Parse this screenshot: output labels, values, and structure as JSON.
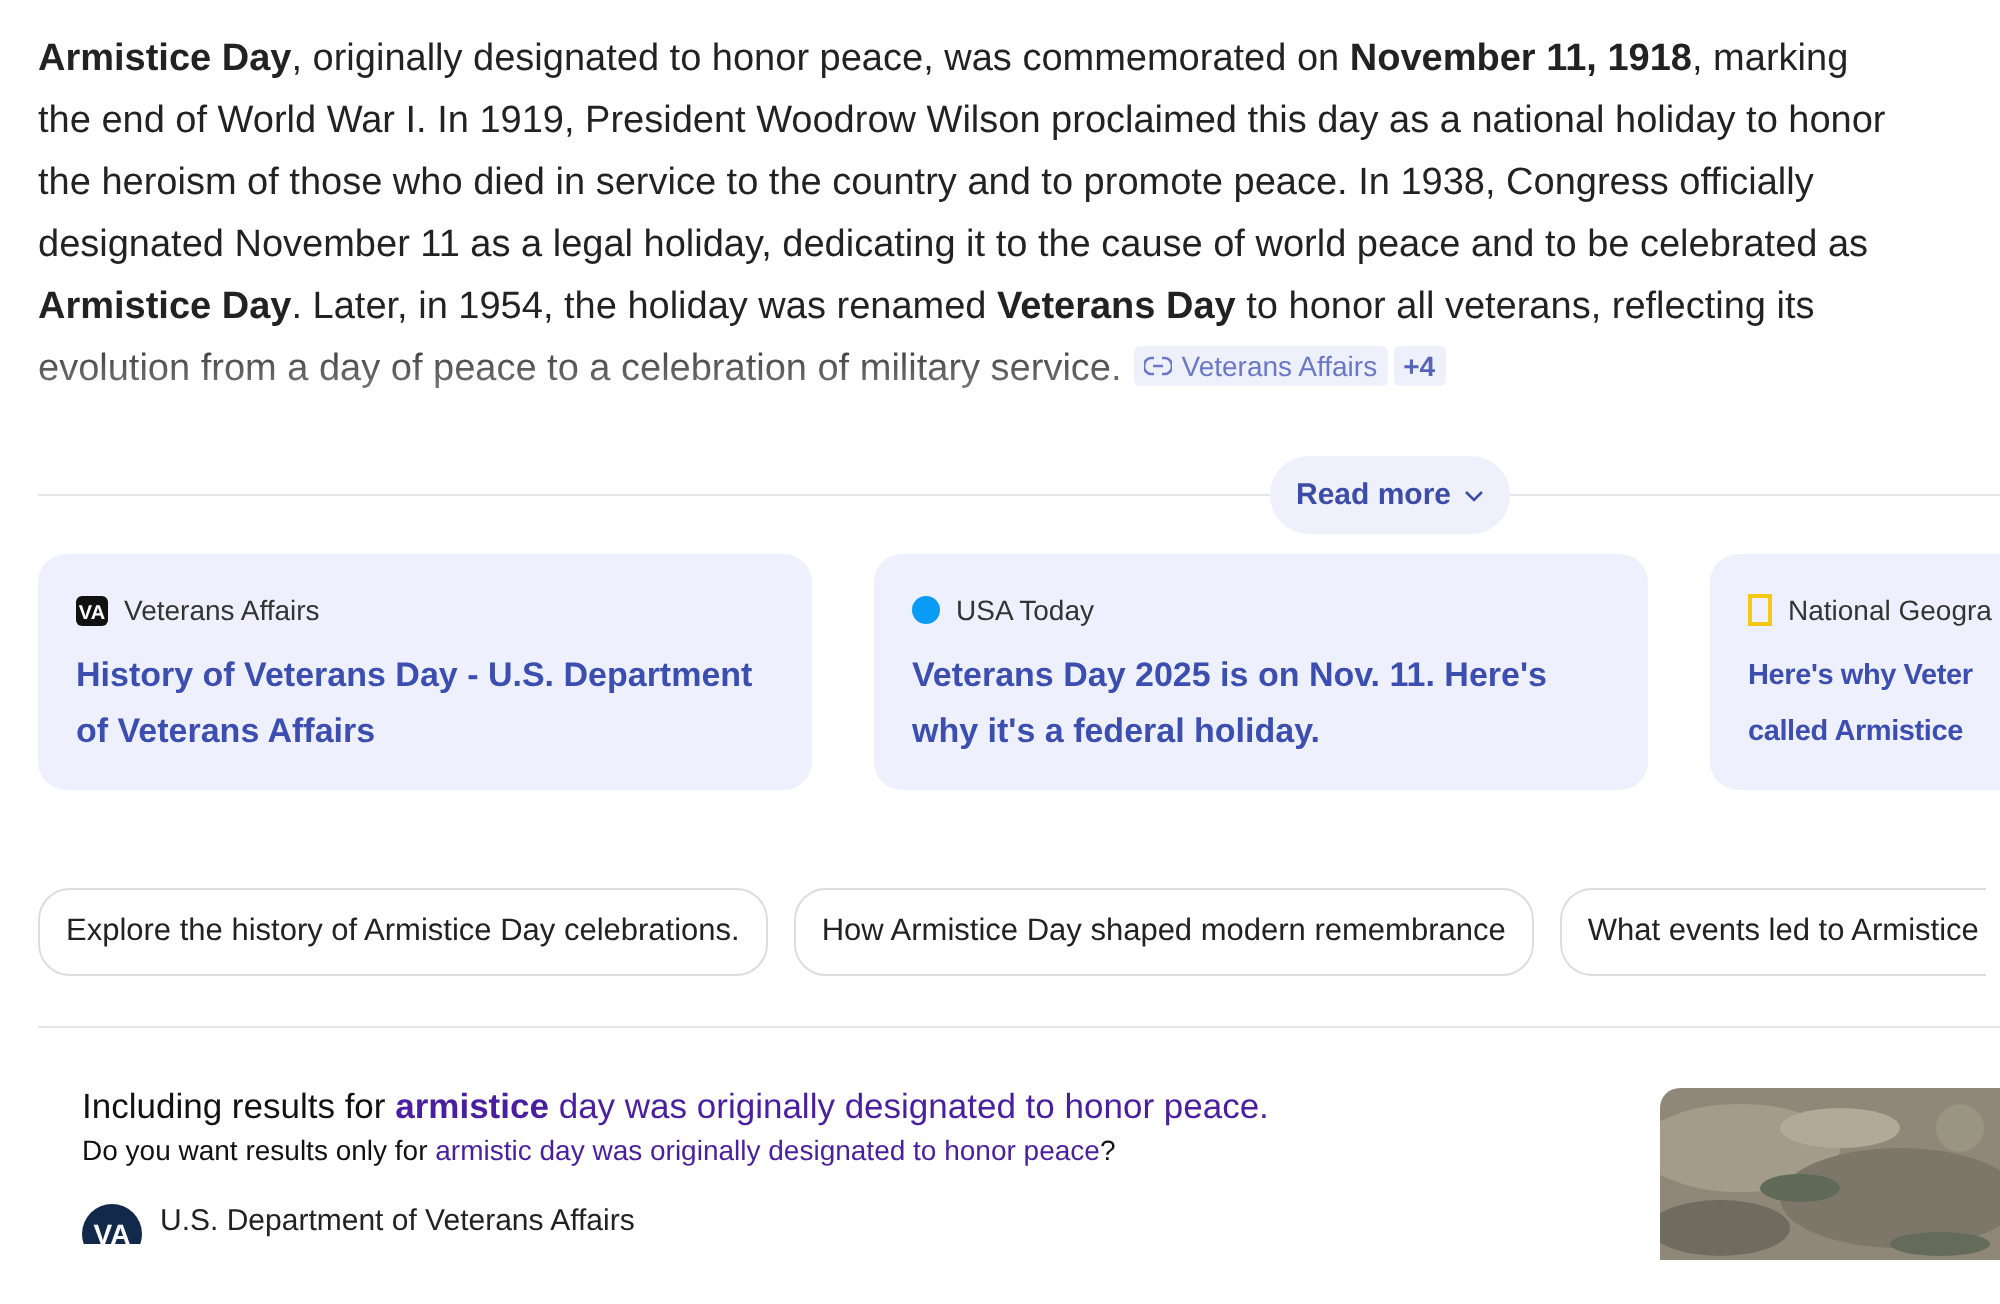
{
  "answer": {
    "paragraph": "**Armistice Day**, originally designated to honor peace, was commemorated on **November 11, 1918**, marking the end of World War I. In 1919, President Woodrow Wilson proclaimed this day as a national holiday to honor the heroism of those who died in service to the country and to promote peace. In 1938, Congress officially designated November 11 as a legal holiday, dedicating it to the cause of world peace and to be celebrated as **Armistice Day**. Later, in 1954, the holiday was renamed **Veterans Day** to honor all veterans, reflecting its evolution from a day of peace to a celebration of military service.",
    "citation": "Veterans Affairs",
    "more_sources": "+4"
  },
  "read_more": "Read more",
  "sources": [
    {
      "kind": "va",
      "logo_text": "VA",
      "site": "Veterans Affairs",
      "title": "History of Veterans Day - U.S. Department of Veterans Affairs"
    },
    {
      "kind": "dot",
      "site": "USA Today",
      "title": "Veterans Day 2025 is on Nov. 11. Here's why it's a federal holiday."
    },
    {
      "kind": "frame",
      "site": "National Geogra",
      "title": "Here's why Veter\ncalled Armistice"
    }
  ],
  "suggestions": [
    "Explore the history of Armistice Day celebrations.",
    "How Armistice Day shaped modern remembrance",
    "What events led to Armistice"
  ],
  "result": {
    "including": "Including results for",
    "corrected_query": "**armistice** day was originally designated to honor peace.",
    "question": "Do you want results only for",
    "original_query": "armistic day was originally designated to honor peace",
    "question_end": "?",
    "source_logo": "VA",
    "source": "U.S. Department of Veterans Affairs"
  }
}
